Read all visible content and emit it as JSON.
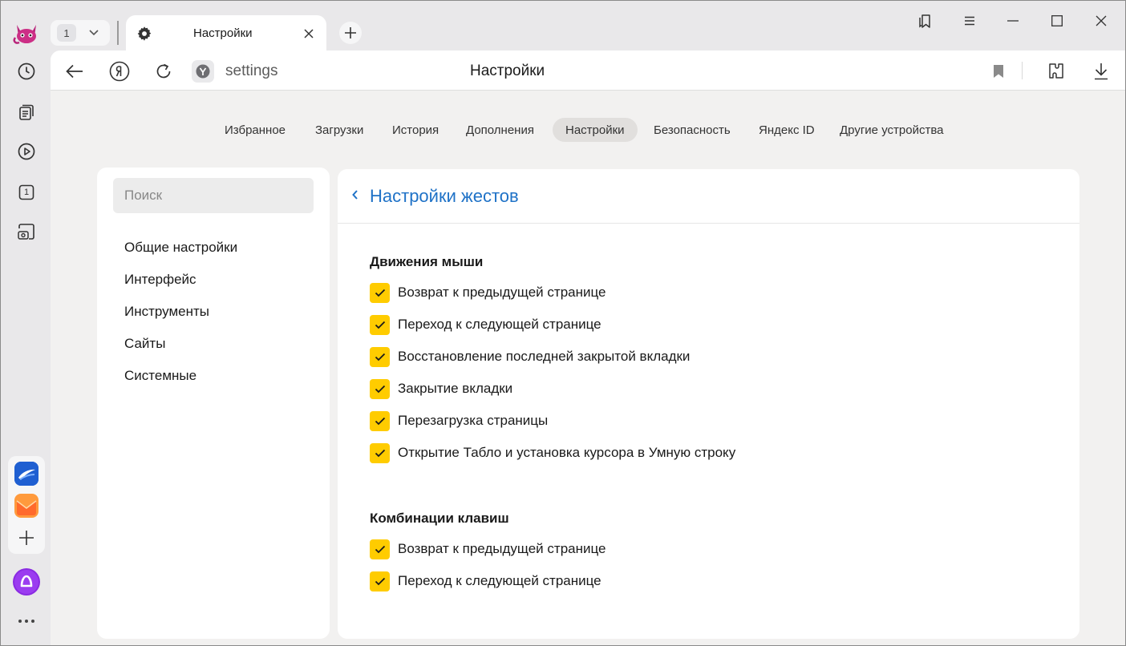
{
  "browser": {
    "tab_count": "1",
    "tab_title": "Настройки",
    "address_text": "settings",
    "page_heading": "Настройки"
  },
  "nav_tabs": [
    {
      "label": "Избранное"
    },
    {
      "label": "Загрузки"
    },
    {
      "label": "История"
    },
    {
      "label": "Дополнения"
    },
    {
      "label": "Настройки",
      "active": true
    },
    {
      "label": "Безопасность"
    },
    {
      "label": "Яндекс ID"
    },
    {
      "label": "Другие устройства"
    }
  ],
  "sidebar": {
    "search_placeholder": "Поиск",
    "items": [
      "Общие настройки",
      "Интерфейс",
      "Инструменты",
      "Сайты",
      "Системные"
    ]
  },
  "panel": {
    "title": "Настройки жестов",
    "sections": [
      {
        "title": "Движения мыши",
        "options": [
          {
            "label": "Возврат к предыдущей странице",
            "checked": true
          },
          {
            "label": "Переход к следующей странице",
            "checked": true
          },
          {
            "label": "Восстановление последней закрытой вкладки",
            "checked": true
          },
          {
            "label": "Закрытие вкладки",
            "checked": true
          },
          {
            "label": "Перезагрузка страницы",
            "checked": true
          },
          {
            "label": "Открытие Табло и установка курсора в Умную строку",
            "checked": true
          }
        ]
      },
      {
        "title": "Комбинации клавиш",
        "options": [
          {
            "label": "Возврат к предыдущей странице",
            "checked": true
          },
          {
            "label": "Переход к следующей странице",
            "checked": true
          }
        ]
      }
    ]
  },
  "rail_counter": "1",
  "colors": {
    "accent_link": "#1f72c7",
    "checkbox": "#ffcc00",
    "alice": "#8a2be2"
  },
  "icons": {
    "rail": [
      "browser-logo-icon",
      "history-icon",
      "collections-icon",
      "play-icon",
      "tab-counter-icon",
      "screenshot-icon",
      "messenger-icon",
      "mail-icon",
      "plus-icon",
      "alice-icon",
      "more-icon"
    ],
    "toolbar": [
      "back-arrow-icon",
      "yandex-icon",
      "reload-icon",
      "site-icon",
      "bookmark-icon",
      "extensions-icon",
      "download-icon"
    ]
  }
}
